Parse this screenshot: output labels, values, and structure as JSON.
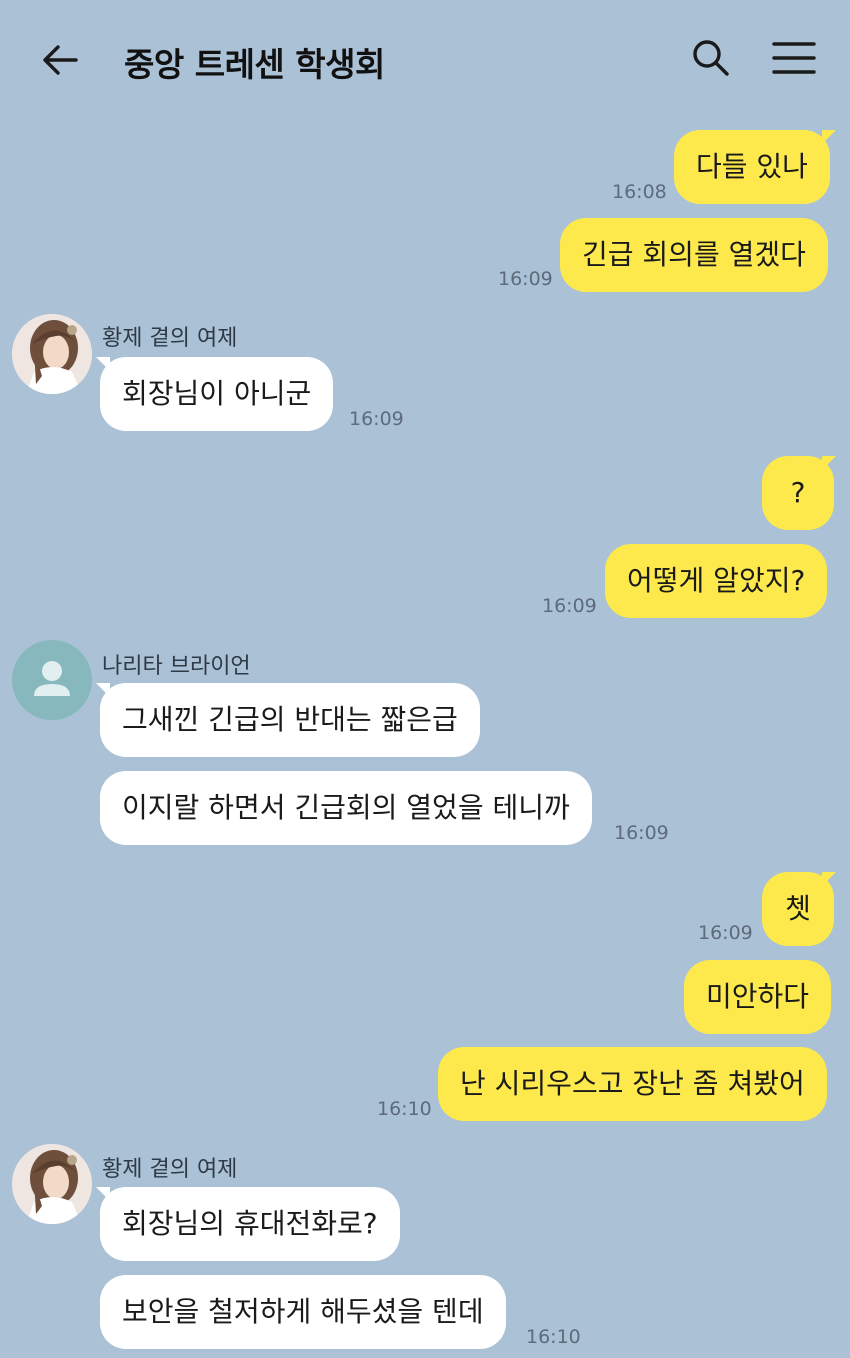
{
  "header": {
    "title": "중앙 트레센 학생회"
  },
  "messages": {
    "m1": {
      "text": "다들 있나",
      "time": "16:08"
    },
    "m2": {
      "text": "긴급 회의를 열겠다",
      "time": "16:09"
    },
    "m3": {
      "sender": "황제 곁의 여제",
      "text": "회장님이 아니군",
      "time": "16:09"
    },
    "m4": {
      "text": "?"
    },
    "m5": {
      "text": "어떻게 알았지?",
      "time": "16:09"
    },
    "m6": {
      "sender": "나리타 브라이언",
      "text": "그새낀 긴급의 반대는 짧은급"
    },
    "m7": {
      "text": "이지랄 하면서 긴급회의 열었을 테니까",
      "time": "16:09"
    },
    "m8": {
      "text": "쳇",
      "time": "16:09"
    },
    "m9": {
      "text": "미안하다"
    },
    "m10": {
      "text": "난 시리우스고 장난 좀 쳐봤어",
      "time": "16:10"
    },
    "m11": {
      "sender": "황제 곁의 여제",
      "text": "회장님의 휴대전화로?"
    },
    "m12": {
      "text": "보안을 철저하게 해두셨을 텐데",
      "time": "16:10"
    }
  },
  "colors": {
    "background": "#abc1d6",
    "my_bubble": "#fee94d",
    "their_bubble": "#ffffff"
  },
  "icons": {
    "back": "arrow-left-icon",
    "search": "search-icon",
    "menu": "hamburger-menu-icon",
    "profile_default": "person-icon"
  }
}
